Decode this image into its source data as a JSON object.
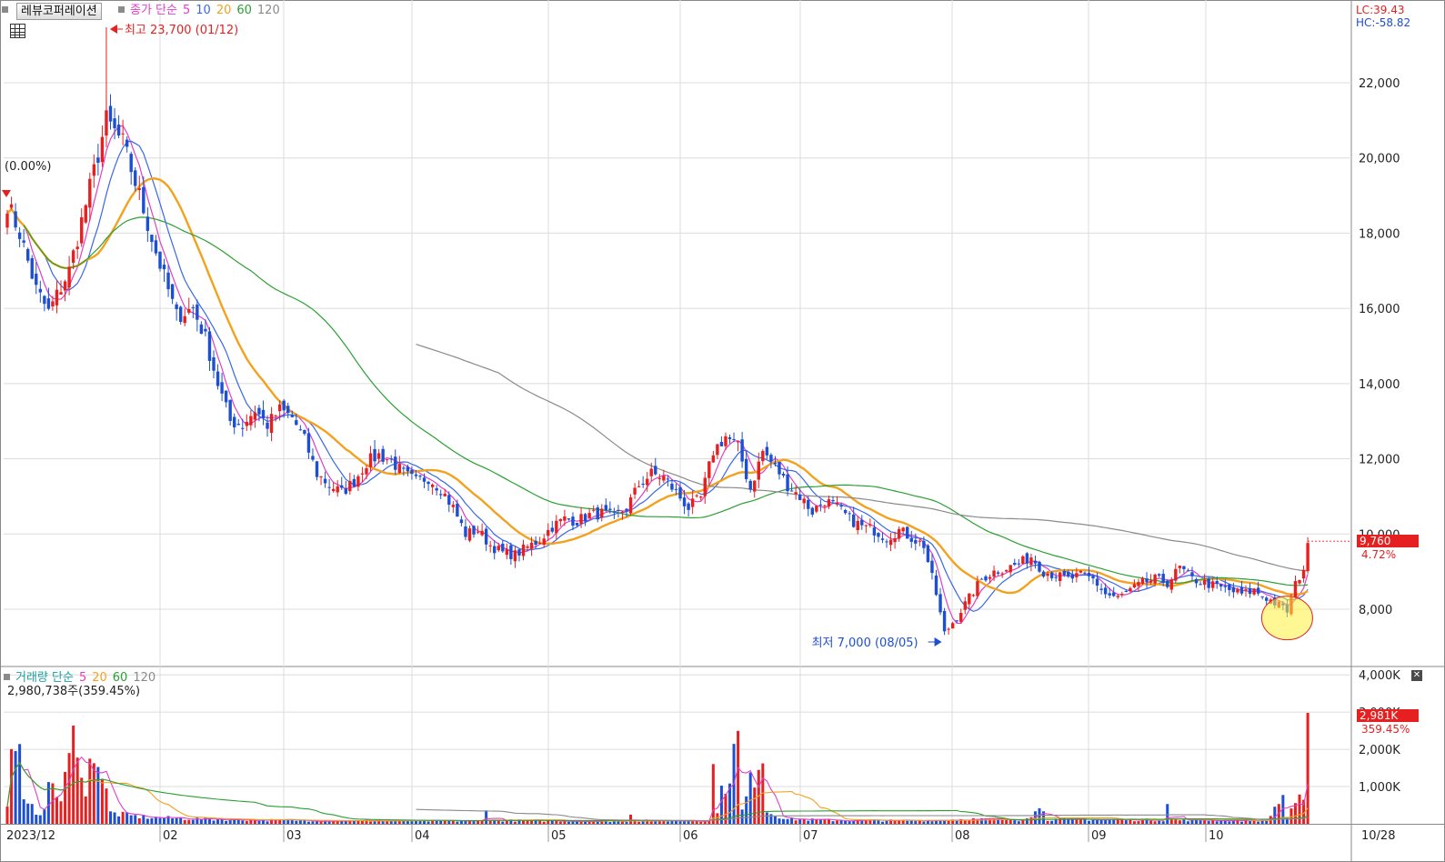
{
  "stock_name": "레뷰코퍼레이션",
  "price_legend": {
    "label": "종가 단순",
    "ma": [
      "5",
      "10",
      "20",
      "60",
      "120"
    ]
  },
  "volume_legend": {
    "label": "거래량 단순",
    "ma": [
      "5",
      "20",
      "60",
      "120"
    ]
  },
  "colors": {
    "up": "#e62020",
    "down": "#1c4fd2",
    "ma5": "#e040c8",
    "ma10": "#3a68e8",
    "ma20": "#f2a21e",
    "ma60": "#2aa032",
    "ma120": "#8a8a8a",
    "grid": "#dcdcdc",
    "axis_text": "#222222",
    "price_tag": "#e62020"
  },
  "lc_text": "LC:39.43",
  "hc_text": "HC:-58.82",
  "pct_label": "(0.00%)",
  "max_label": "최고 23,700 (01/12)",
  "min_label": "최저 7,000 (08/05)",
  "current_price": "9,760",
  "current_change": "4.72%",
  "volume_info": "2,980,738주(359.45%)",
  "current_volume": "2,981K",
  "current_volume_pct": "359.45%",
  "chart_data": {
    "type": "candlestick",
    "x_labels": [
      "2023/12",
      "02",
      "03",
      "04",
      "05",
      "06",
      "07",
      "08",
      "09",
      "10",
      "10/28"
    ],
    "y_ticks": [
      "8,000",
      "10,000",
      "12,000",
      "14,000",
      "16,000",
      "18,000",
      "20,000",
      "22,000"
    ],
    "y_range": [
      6500,
      24200
    ],
    "volume_ticks": [
      "1,000K",
      "2,000K",
      "3,000K",
      "4,000K"
    ],
    "volume_range": [
      0,
      4200
    ],
    "close_waypoints": [
      [
        0,
        18800
      ],
      [
        3,
        18000
      ],
      [
        7,
        16500
      ],
      [
        10,
        15900
      ],
      [
        15,
        17000
      ],
      [
        20,
        19200
      ],
      [
        24,
        21000
      ],
      [
        28,
        20400
      ],
      [
        32,
        19000
      ],
      [
        36,
        17500
      ],
      [
        41,
        15800
      ],
      [
        45,
        16000
      ],
      [
        48,
        15200
      ],
      [
        51,
        14000
      ],
      [
        54,
        13000
      ],
      [
        57,
        12900
      ],
      [
        60,
        13300
      ],
      [
        63,
        12900
      ],
      [
        66,
        13300
      ],
      [
        69,
        13100
      ],
      [
        72,
        12500
      ],
      [
        75,
        11600
      ],
      [
        78,
        11300
      ],
      [
        81,
        11100
      ],
      [
        84,
        11400
      ],
      [
        87,
        11900
      ],
      [
        90,
        12100
      ],
      [
        93,
        11950
      ],
      [
        96,
        11600
      ],
      [
        99,
        11400
      ],
      [
        102,
        11500
      ],
      [
        105,
        11200
      ],
      [
        108,
        10700
      ],
      [
        111,
        10000
      ],
      [
        114,
        10100
      ],
      [
        117,
        9700
      ],
      [
        120,
        9500
      ],
      [
        123,
        9450
      ],
      [
        126,
        9650
      ],
      [
        129,
        9850
      ],
      [
        132,
        10200
      ],
      [
        135,
        10400
      ],
      [
        138,
        10350
      ],
      [
        141,
        10500
      ],
      [
        144,
        10550
      ],
      [
        147,
        10450
      ],
      [
        150,
        10700
      ],
      [
        153,
        11300
      ],
      [
        156,
        11600
      ],
      [
        159,
        11500
      ],
      [
        162,
        11100
      ],
      [
        165,
        10700
      ],
      [
        168,
        10950
      ],
      [
        171,
        12200
      ],
      [
        174,
        12600
      ],
      [
        177,
        12300
      ],
      [
        180,
        11200
      ],
      [
        183,
        12200
      ],
      [
        186,
        11800
      ],
      [
        189,
        11300
      ],
      [
        192,
        11000
      ],
      [
        195,
        10600
      ],
      [
        198,
        10900
      ],
      [
        201,
        10700
      ],
      [
        204,
        10400
      ],
      [
        207,
        10200
      ],
      [
        210,
        10100
      ],
      [
        213,
        9900
      ],
      [
        216,
        10100
      ],
      [
        219,
        9900
      ],
      [
        222,
        9700
      ],
      [
        225,
        8400
      ],
      [
        227,
        7350
      ],
      [
        230,
        7800
      ],
      [
        233,
        8300
      ],
      [
        236,
        8800
      ],
      [
        239,
        9000
      ],
      [
        242,
        9100
      ],
      [
        245,
        9200
      ],
      [
        248,
        9400
      ],
      [
        251,
        9000
      ],
      [
        254,
        8900
      ],
      [
        257,
        8800
      ],
      [
        260,
        8900
      ],
      [
        263,
        8800
      ],
      [
        266,
        8400
      ],
      [
        269,
        8300
      ],
      [
        272,
        8500
      ],
      [
        275,
        8700
      ],
      [
        278,
        8800
      ],
      [
        281,
        8700
      ],
      [
        284,
        9100
      ],
      [
        287,
        8800
      ],
      [
        290,
        8700
      ],
      [
        293,
        8600
      ],
      [
        296,
        8500
      ],
      [
        299,
        8400
      ],
      [
        302,
        8500
      ],
      [
        305,
        8300
      ],
      [
        308,
        8100
      ],
      [
        310,
        7950
      ],
      [
        312,
        8650
      ],
      [
        314,
        9100
      ],
      [
        315,
        9760
      ]
    ],
    "volume_waypoints": [
      [
        0,
        500
      ],
      [
        2,
        3500
      ],
      [
        4,
        600
      ],
      [
        8,
        350
      ],
      [
        11,
        1300
      ],
      [
        13,
        700
      ],
      [
        17,
        3200
      ],
      [
        19,
        800
      ],
      [
        21,
        2700
      ],
      [
        25,
        350
      ],
      [
        30,
        250
      ],
      [
        35,
        200
      ],
      [
        40,
        180
      ],
      [
        50,
        140
      ],
      [
        60,
        120
      ],
      [
        80,
        100
      ],
      [
        100,
        90
      ],
      [
        115,
        90
      ],
      [
        116,
        650
      ],
      [
        117,
        110
      ],
      [
        150,
        80
      ],
      [
        151,
        400
      ],
      [
        152,
        90
      ],
      [
        170,
        100
      ],
      [
        171,
        1700
      ],
      [
        172,
        500
      ],
      [
        177,
        2600
      ],
      [
        178,
        400
      ],
      [
        183,
        2500
      ],
      [
        184,
        400
      ],
      [
        189,
        150
      ],
      [
        200,
        110
      ],
      [
        220,
        100
      ],
      [
        233,
        150
      ],
      [
        245,
        120
      ],
      [
        251,
        500
      ],
      [
        252,
        140
      ],
      [
        280,
        120
      ],
      [
        281,
        650
      ],
      [
        282,
        120
      ],
      [
        305,
        100
      ],
      [
        309,
        900
      ],
      [
        310,
        200
      ],
      [
        313,
        700
      ],
      [
        314,
        600
      ],
      [
        315,
        2981
      ]
    ]
  }
}
